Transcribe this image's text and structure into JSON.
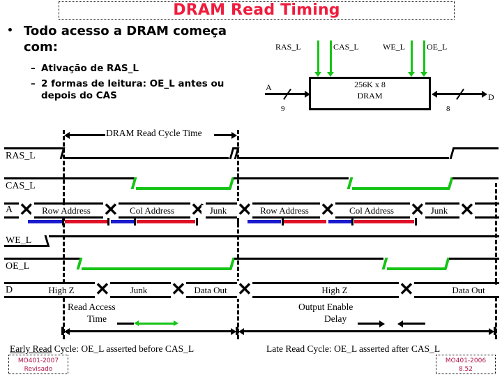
{
  "slide": {
    "title": "DRAM Read Timing",
    "title_color": "#ef1c3c"
  },
  "bullets": {
    "marker": "•",
    "main": "Todo acesso a DRAM começa com:",
    "sub_marker": "–",
    "sub": [
      "Ativação de RAS_L",
      "2 formas de leitura: OE_L antes ou depois do CAS"
    ]
  },
  "block_diagram": {
    "control_signals": [
      "RAS_L",
      "CAS_L",
      "WE_L",
      "OE_L"
    ],
    "chip_line1": "256K x 8",
    "chip_line2": "DRAM",
    "address_label": "A",
    "address_width": "9",
    "data_label": "D",
    "data_width": "8",
    "arrow_color": "#16c416"
  },
  "timing": {
    "cycle_label": "DRAM Read Cycle Time",
    "rows": [
      "RAS_L",
      "CAS_L",
      "A",
      "WE_L",
      "OE_L",
      "D"
    ],
    "address_values": [
      "Row Address",
      "Col Address",
      "Junk",
      "Row Address",
      "Col Address",
      "Junk"
    ],
    "data_values": [
      "High Z",
      "Junk",
      "Data Out",
      "High Z",
      "Data Out"
    ],
    "annotations": {
      "read_access_line1": "Read Access",
      "read_access_line2": "Time",
      "output_enable_line1": "Output Enable",
      "output_enable_line2": "Delay"
    },
    "colors": {
      "green": "#16c416",
      "blue": "#1b1bcf",
      "red": "#e01228"
    }
  },
  "captions": {
    "left_underlined": "Early Read",
    "left_rest": " Cycle: OE_L asserted before CAS_L",
    "right": "Late Read Cycle: OE_L asserted after CAS_L"
  },
  "stamps": {
    "left_line1": "MO401-2007",
    "left_line2": "Revisado",
    "right_line1": "MO401-2006",
    "right_line2": "8.52",
    "color": "#b0104a"
  }
}
